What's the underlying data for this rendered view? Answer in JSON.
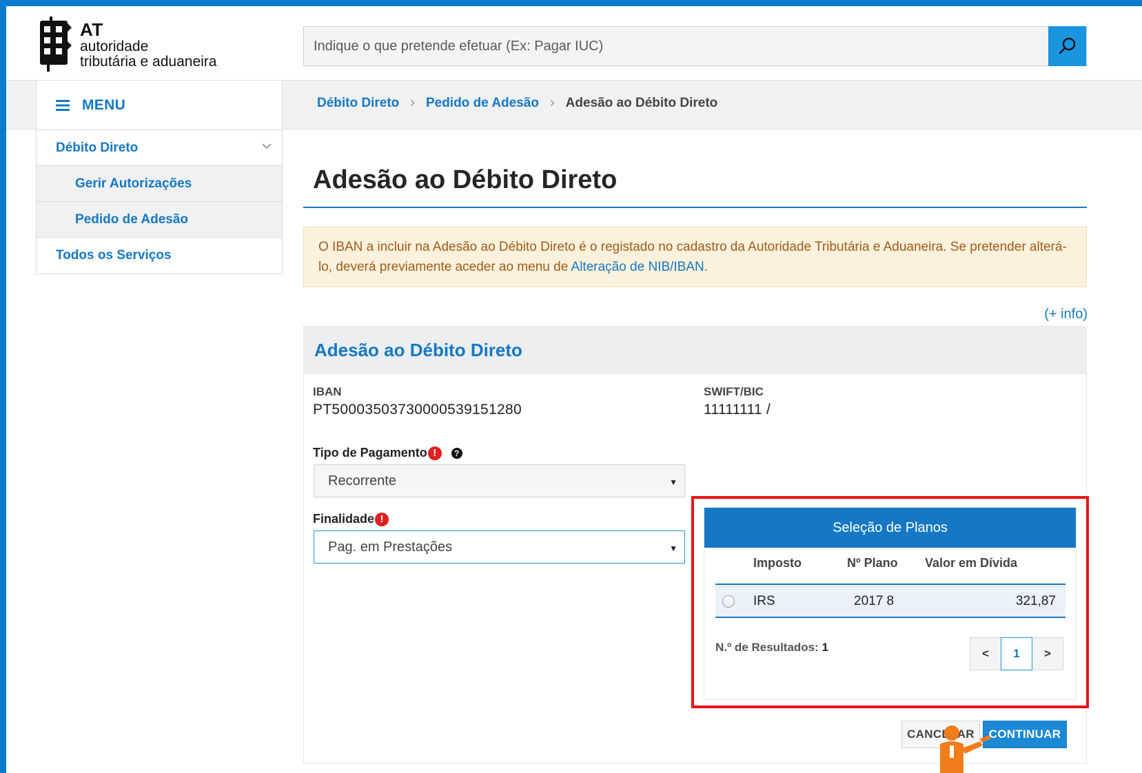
{
  "brand": {
    "short": "AT",
    "line1": "autoridade",
    "line2": "tributária e aduaneira"
  },
  "search": {
    "placeholder": "Indique o que pretende efetuar (Ex: Pagar IUC)",
    "icon": "search-icon"
  },
  "menu": {
    "label": "MENU",
    "icon": "hamburger-icon"
  },
  "breadcrumb": {
    "items": [
      "Débito Direto",
      "Pedido de Adesão"
    ],
    "current": "Adesão ao Débito Direto"
  },
  "sidebar": {
    "items": [
      {
        "label": "Débito Direto"
      },
      {
        "label": "Gerir Autorizações"
      },
      {
        "label": "Pedido de Adesão"
      },
      {
        "label": "Todos os Serviços"
      }
    ]
  },
  "page": {
    "title": "Adesão ao Débito Direto",
    "alert_text": "O IBAN a incluir na Adesão ao Débito Direto é o registado no cadastro da Autoridade Tributária e Aduaneira. Se pretender alterá-lo, deverá previamente aceder ao menu de ",
    "alert_link": "Alteração de NIB/IBAN",
    "alert_end": ".",
    "info_link": "(+ info)"
  },
  "form": {
    "panel_title": "Adesão ao Débito Direto",
    "iban_label": "IBAN",
    "iban_value": "PT50003503730000539151280",
    "swift_label": "SWIFT/BIC",
    "swift_value": "11111111 /",
    "tipo_label": "Tipo de Pagamento",
    "tipo_value": "Recorrente",
    "finalidade_label": "Finalidade",
    "finalidade_value": "Pag. em Prestações",
    "required_mark": "!",
    "help_mark": "?"
  },
  "plans": {
    "title": "Seleção de Planos",
    "columns": [
      "Imposto",
      "Nº Plano",
      "Valor em Dívida"
    ],
    "rows": [
      {
        "imposto": "IRS",
        "plano": "2017 8",
        "valor": "321,87",
        "selected": false
      }
    ],
    "results_label": "N.º de Resultados:",
    "results_count": "1",
    "pager": {
      "prev": "<",
      "page": "1",
      "next": ">"
    }
  },
  "actions": {
    "cancel": "CANCELAR",
    "continue": "CONTINUAR"
  },
  "colors": {
    "frame": "#0a7ccf",
    "accent": "#1578c4",
    "alert_bg": "#fcf1dc",
    "alert_text": "#a15c1b",
    "highlight": "#e8141a",
    "pointer": "#f07c1a"
  }
}
